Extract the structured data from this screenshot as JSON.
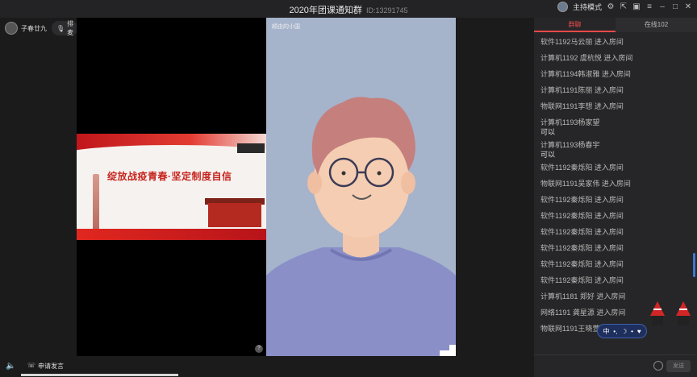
{
  "titlebar": {
    "title": "2020年团课通知群",
    "id_label": "ID:13291745",
    "mode_label": "主持模式"
  },
  "left": {
    "user_name": "子春廿九",
    "mic_label": "排麦"
  },
  "video": {
    "label": "顺由的小国"
  },
  "slide": {
    "text": "绽放战疫青春·坚定制度自信"
  },
  "panel": {
    "tabs": [
      {
        "label": "群聊",
        "active": true
      },
      {
        "label": "在线102",
        "active": false
      }
    ],
    "messages": [
      {
        "text": "软件1192马云丽 进入房间"
      },
      {
        "text": "计算机1192 虞杭悦 进入房间"
      },
      {
        "text": "计算机1194韩淑雅 进入房间"
      },
      {
        "text": "计算机1191陈丽 进入房间"
      },
      {
        "text": "物联网1191李想 进入房间"
      },
      {
        "text": "计算机1193杨家望",
        "sub": "可以"
      },
      {
        "text": "计算机1193杨春宇",
        "sub": "可以"
      },
      {
        "text": "软件1192秦烁阳 进入房间"
      },
      {
        "text": "物联网1191吴家伟 进入房间"
      },
      {
        "text": "软件1192秦烁阳 进入房间"
      },
      {
        "text": "软件1192秦烁阳 进入房间"
      },
      {
        "text": "软件1192秦烁阳 进入房间"
      },
      {
        "text": "软件1192秦烁阳 进入房间"
      },
      {
        "text": "软件1192秦烁阳 进入房间"
      },
      {
        "text": "软件1192秦烁阳 进入房间"
      },
      {
        "text": "计算机1181 郑好 进入房间"
      },
      {
        "text": "网络1191 龚星源 进入房间"
      },
      {
        "text": "物联网1191王晓萱 进入房间"
      }
    ],
    "send_label": "发送"
  },
  "bottom": {
    "apply_label": "申请发言"
  },
  "ime": {
    "lang": "中"
  },
  "colors": {
    "accent": "#e94a4a",
    "video_bg": "#a5b3cb"
  }
}
